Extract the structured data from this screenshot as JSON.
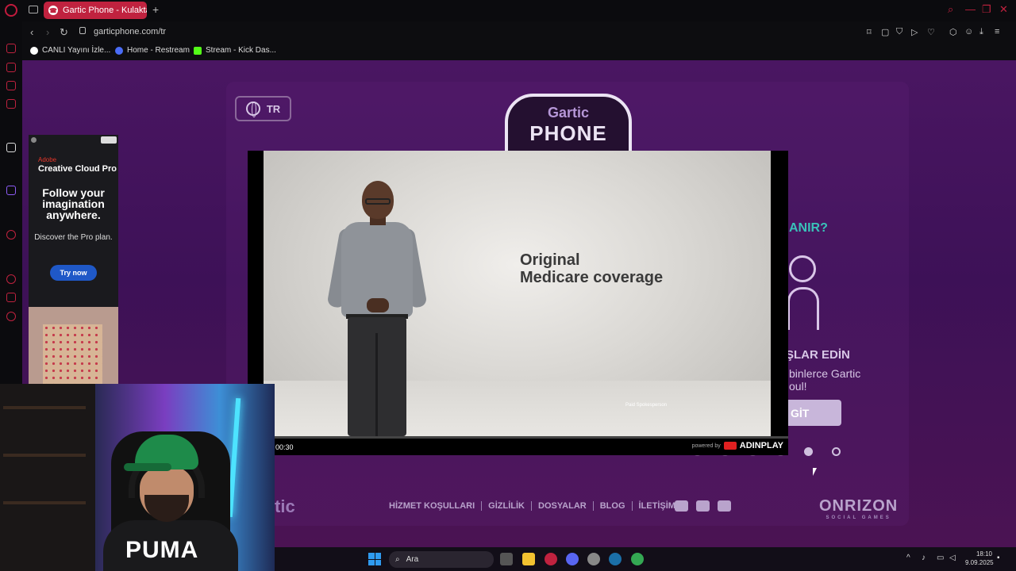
{
  "browser": {
    "tab_title": "Gartic Phone - Kulakta",
    "url": "garticphone.com/tr",
    "bookmarks": [
      {
        "label": "CANLI Yayını İzle..."
      },
      {
        "label": "Home - Restream"
      },
      {
        "label": "Stream - Kick Das..."
      }
    ]
  },
  "page": {
    "language_button": "TR",
    "logo_line1": "Gartic",
    "logo_line2": "PHONE",
    "how_title": "ANIR?",
    "how_subtitle": "ŞLAR EDİN",
    "how_desc_line1": "binlerce Gartic",
    "how_desc_line2": "oul!",
    "git_button": "GİT",
    "footer_tic": "tic",
    "footer_links": [
      "HİZMET KOŞULLARI",
      "GİZLİLİK",
      "DOSYALAR",
      "BLOG",
      "İLETİŞİM"
    ],
    "brand": "ONRIZON",
    "brand_sub": "SOCIAL GAMES"
  },
  "left_ad": {
    "brand_small": "Adobe",
    "brand": "Creative Cloud Pro",
    "headline": "Follow your imagination anywhere.",
    "subline": "Discover the Pro plan.",
    "cta": "Try now"
  },
  "video_ad": {
    "line1": "Original",
    "line2": "Medicare coverage",
    "disclaimer": "Paid Spokesperson",
    "time": "00:30",
    "powered_by": "powered by",
    "provider": "ADINPLAY"
  },
  "webcam": {
    "shirt_text": "PUMA"
  },
  "taskbar": {
    "search_label": "Ara",
    "time": "18:10",
    "date": "9.09.2025"
  },
  "colors": {
    "accent": "#c0223f",
    "page_bg": "#4a1662",
    "teal": "#39c2b9"
  }
}
